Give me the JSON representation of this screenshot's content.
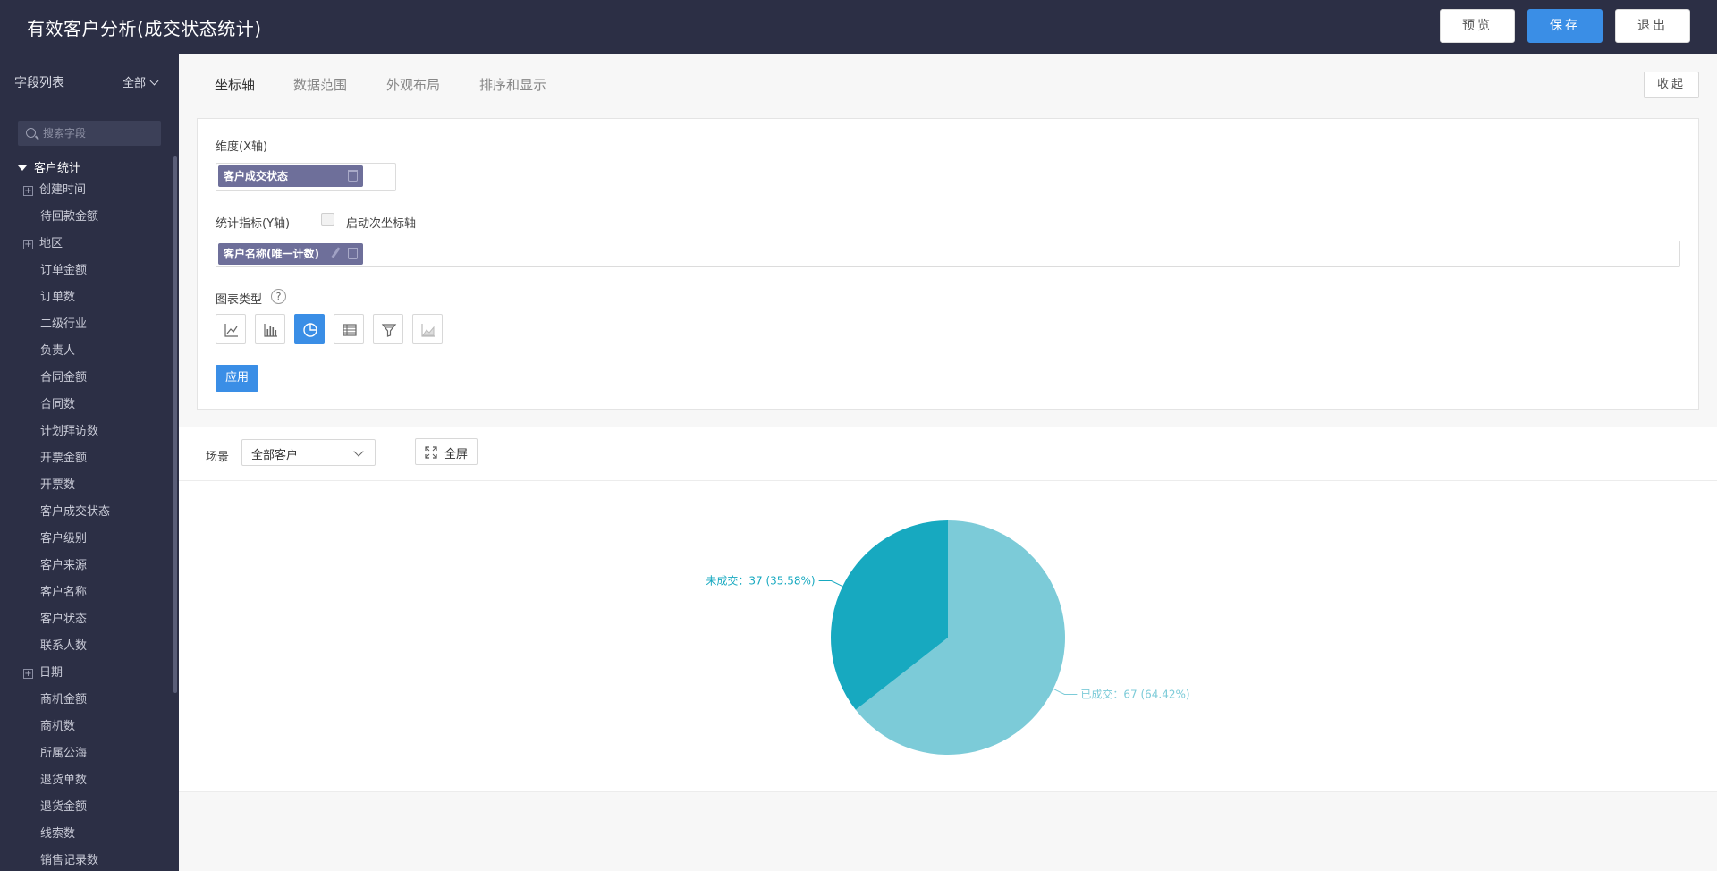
{
  "header": {
    "title": "有效客户分析(成交状态统计)",
    "preview_label": "预览",
    "save_label": "保存",
    "exit_label": "退出"
  },
  "sidebar": {
    "title": "字段列表",
    "filter": "全部",
    "search_placeholder": "搜索字段",
    "root": "客户统计",
    "items": [
      {
        "label": "创建时间",
        "expandable": true
      },
      {
        "label": "待回款金额",
        "expandable": false
      },
      {
        "label": "地区",
        "expandable": true
      },
      {
        "label": "订单金额",
        "expandable": false
      },
      {
        "label": "订单数",
        "expandable": false
      },
      {
        "label": "二级行业",
        "expandable": false
      },
      {
        "label": "负责人",
        "expandable": false
      },
      {
        "label": "合同金额",
        "expandable": false
      },
      {
        "label": "合同数",
        "expandable": false
      },
      {
        "label": "计划拜访数",
        "expandable": false
      },
      {
        "label": "开票金额",
        "expandable": false
      },
      {
        "label": "开票数",
        "expandable": false
      },
      {
        "label": "客户成交状态",
        "expandable": false
      },
      {
        "label": "客户级别",
        "expandable": false
      },
      {
        "label": "客户来源",
        "expandable": false
      },
      {
        "label": "客户名称",
        "expandable": false
      },
      {
        "label": "客户状态",
        "expandable": false
      },
      {
        "label": "联系人数",
        "expandable": false
      },
      {
        "label": "日期",
        "expandable": true
      },
      {
        "label": "商机金额",
        "expandable": false
      },
      {
        "label": "商机数",
        "expandable": false
      },
      {
        "label": "所属公海",
        "expandable": false
      },
      {
        "label": "退货单数",
        "expandable": false
      },
      {
        "label": "退货金额",
        "expandable": false
      },
      {
        "label": "线索数",
        "expandable": false
      },
      {
        "label": "销售记录数",
        "expandable": false
      }
    ]
  },
  "tabs": [
    "坐标轴",
    "数据范围",
    "外观布局",
    "排序和显示"
  ],
  "collapse_label": "收起",
  "config": {
    "dimension_label": "维度(X轴)",
    "dimension_chip": "客户成交状态",
    "metric_label": "统计指标(Y轴)",
    "secondary_axis_label": "启动次坐标轴",
    "metric_chip": "客户名称(唯一计数)",
    "chart_type_label": "图表类型",
    "help_glyph": "?",
    "chart_types": [
      "line-chart-icon",
      "bar-chart-icon",
      "pie-chart-icon",
      "table-icon",
      "funnel-icon",
      "area-chart-icon"
    ],
    "active_chart_type": "pie-chart-icon",
    "apply_label": "应用"
  },
  "scene": {
    "label": "场景",
    "selected": "全部客户",
    "fullscreen_label": "全屏"
  },
  "colors": {
    "accent": "#3a8ee6",
    "header_bg": "#2c2f45",
    "chip_bg": "#6e6f9a",
    "slice_done": "#7ccbd8",
    "slice_not_done": "#17a9c0"
  },
  "chart_data": {
    "type": "pie",
    "slices": [
      {
        "name": "已成交",
        "value": 67,
        "percent": "64.42%",
        "color": "#7ccbd8",
        "label": "已成交：67 (64.42%)"
      },
      {
        "name": "未成交",
        "value": 37,
        "percent": "35.58%",
        "color": "#17a9c0",
        "label": "未成交：37 (35.58%)"
      }
    ]
  }
}
